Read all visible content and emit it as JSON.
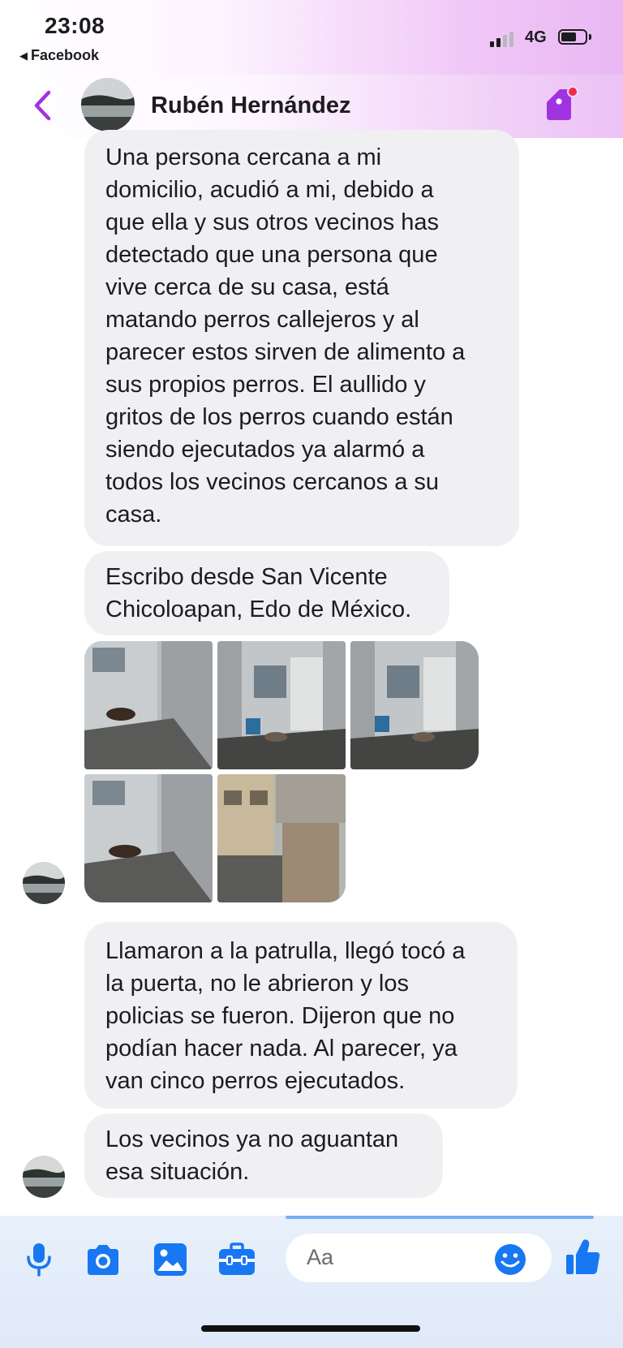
{
  "status_bar": {
    "time": "23:08",
    "back_app_label": "Facebook",
    "network": "4G"
  },
  "header": {
    "contact_name": "Rubén Hernández",
    "icons": [
      "back-chevron-icon",
      "tag-icon"
    ],
    "accent_color": "#a033e0"
  },
  "messages": [
    {
      "lines": [
        "Una persona cercana a mi",
        "domicilio, acudió a mi, debido a",
        "que ella y sus otros vecinos has",
        "detectado que una persona que",
        "vive cerca de su casa, está",
        "matando perros callejeros y al",
        "parecer estos sirven de alimento a",
        "sus propios perros. El aullido y",
        "gritos de los perros cuando están",
        "siendo ejecutados ya alarmó a",
        "todos los vecinos cercanos a su",
        "casa."
      ]
    },
    {
      "lines": [
        "Escribo desde San Vicente",
        "Chicoloapan, Edo de México."
      ]
    },
    {
      "lines": [
        "Llamaron a la patrulla, llegó tocó a",
        "la puerta, no le abrieron y los",
        "policias se fueron. Dijeron que no",
        "podían hacer nada. Al parecer, ya",
        "van cinco perros ejecutados."
      ]
    },
    {
      "lines": [
        "Los vecinos ya no aguantan",
        "esa situación."
      ]
    }
  ],
  "photo_count": 5,
  "composer": {
    "placeholder": "Aa",
    "icons": [
      "microphone-icon",
      "camera-icon",
      "gallery-icon",
      "toolbox-icon",
      "emoji-icon",
      "thumbs-up-icon"
    ],
    "icon_color": "#1877f2"
  }
}
